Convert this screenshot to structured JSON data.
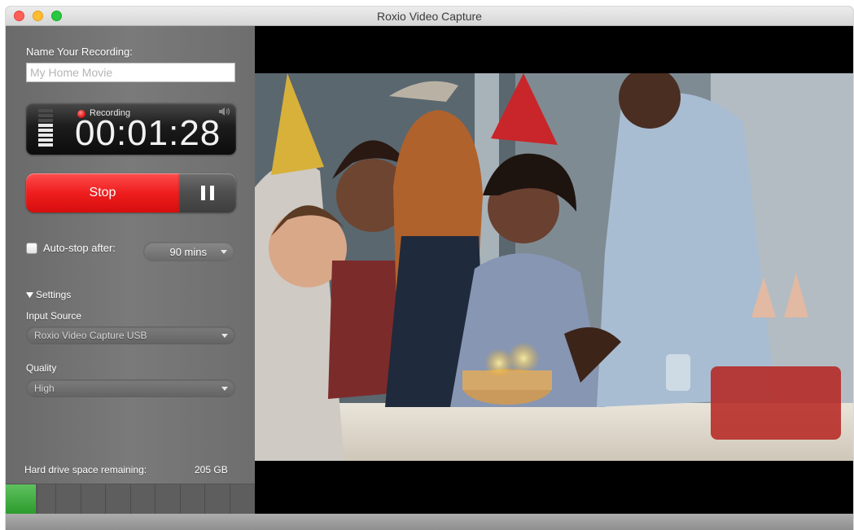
{
  "window": {
    "title": "Roxio Video Capture"
  },
  "recording": {
    "name_label": "Name Your Recording:",
    "name_placeholder": "My Home Movie",
    "status_label": "Recording",
    "elapsed": "00:01:28"
  },
  "controls": {
    "stop_label": "Stop"
  },
  "autostop": {
    "label": "Auto-stop after:",
    "value": "90 mins",
    "checked": false
  },
  "settings": {
    "header": "Settings",
    "input_source_label": "Input Source",
    "input_source_value": "Roxio Video Capture USB",
    "quality_label": "Quality",
    "quality_value": "High"
  },
  "storage": {
    "label": "Hard drive space remaining:",
    "value": "205 GB",
    "meter_fill_fraction": 0.12
  },
  "colors": {
    "record_red": "#ef1e1e",
    "meter_green": "#2b9a2b",
    "sidebar_gray": "#6f6f6f"
  },
  "icons": [
    "close-icon",
    "minimize-icon",
    "zoom-icon",
    "record-dot-icon",
    "speaker-icon",
    "pause-icon",
    "disclosure-triangle-icon",
    "chevron-down-icon"
  ]
}
